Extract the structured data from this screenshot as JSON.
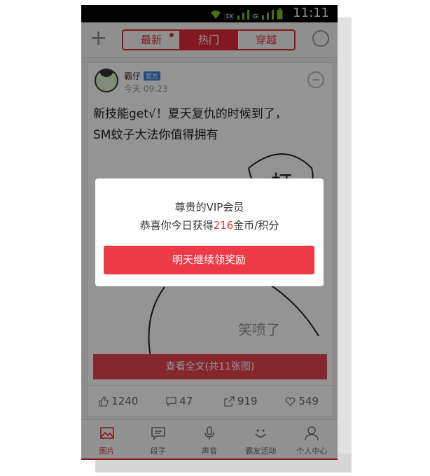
{
  "status": {
    "time": "11:11",
    "net1": "1X",
    "net2": "G"
  },
  "header": {
    "tabs": [
      {
        "label": "最新",
        "dot": true
      },
      {
        "label": "热门",
        "active": true
      },
      {
        "label": "穿越"
      }
    ]
  },
  "post": {
    "username": "霸仔",
    "badge": "官方",
    "time": "今天 09:23",
    "text_line1": "新技能get√！夏天复仇的时候到了，",
    "text_line2": "SM蚊子大法你值得拥有",
    "art_text": "打",
    "watermark": "笑喷了",
    "view_full": "查看全文(共11张图)",
    "likes": "1240",
    "comments": "47",
    "shares": "919",
    "favorites": "549"
  },
  "nav": [
    {
      "label": "图片",
      "icon": "picture-icon",
      "active": true
    },
    {
      "label": "段子",
      "icon": "chat-icon"
    },
    {
      "label": "声音",
      "icon": "microphone-icon"
    },
    {
      "label": "霸友活动",
      "icon": "smile-icon"
    },
    {
      "label": "个人中心",
      "icon": "person-icon"
    }
  ],
  "dialog": {
    "title": "尊贵的VIP会员",
    "msg_prefix": "恭喜你今日获得",
    "msg_amount": "216",
    "msg_suffix": "金币/积分",
    "button": "明天继续领奖励"
  },
  "colors": {
    "accent": "#e02b3a",
    "button": "#ed3a47",
    "badge": "#3a83d6"
  }
}
